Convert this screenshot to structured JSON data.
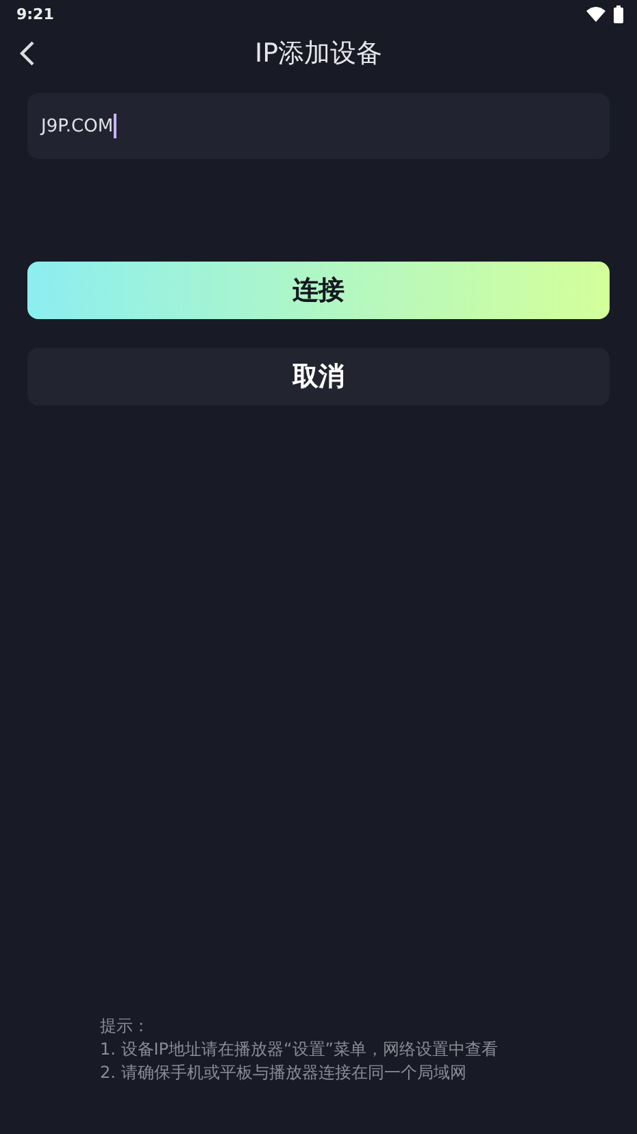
{
  "status_bar": {
    "time": "9:21"
  },
  "header": {
    "title": "IP添加设备"
  },
  "ip_field": {
    "value": "J9P.COM"
  },
  "buttons": [
    {
      "label": "连接",
      "kind": "primary"
    },
    {
      "label": "取消",
      "kind": "secondary"
    }
  ],
  "hints": {
    "title": "提示：",
    "lines": [
      "1. 设备IP地址请在播放器“设置”菜单，网络设置中查看",
      "2. 请确保手机或平板与播放器连接在同一个局域网"
    ]
  }
}
